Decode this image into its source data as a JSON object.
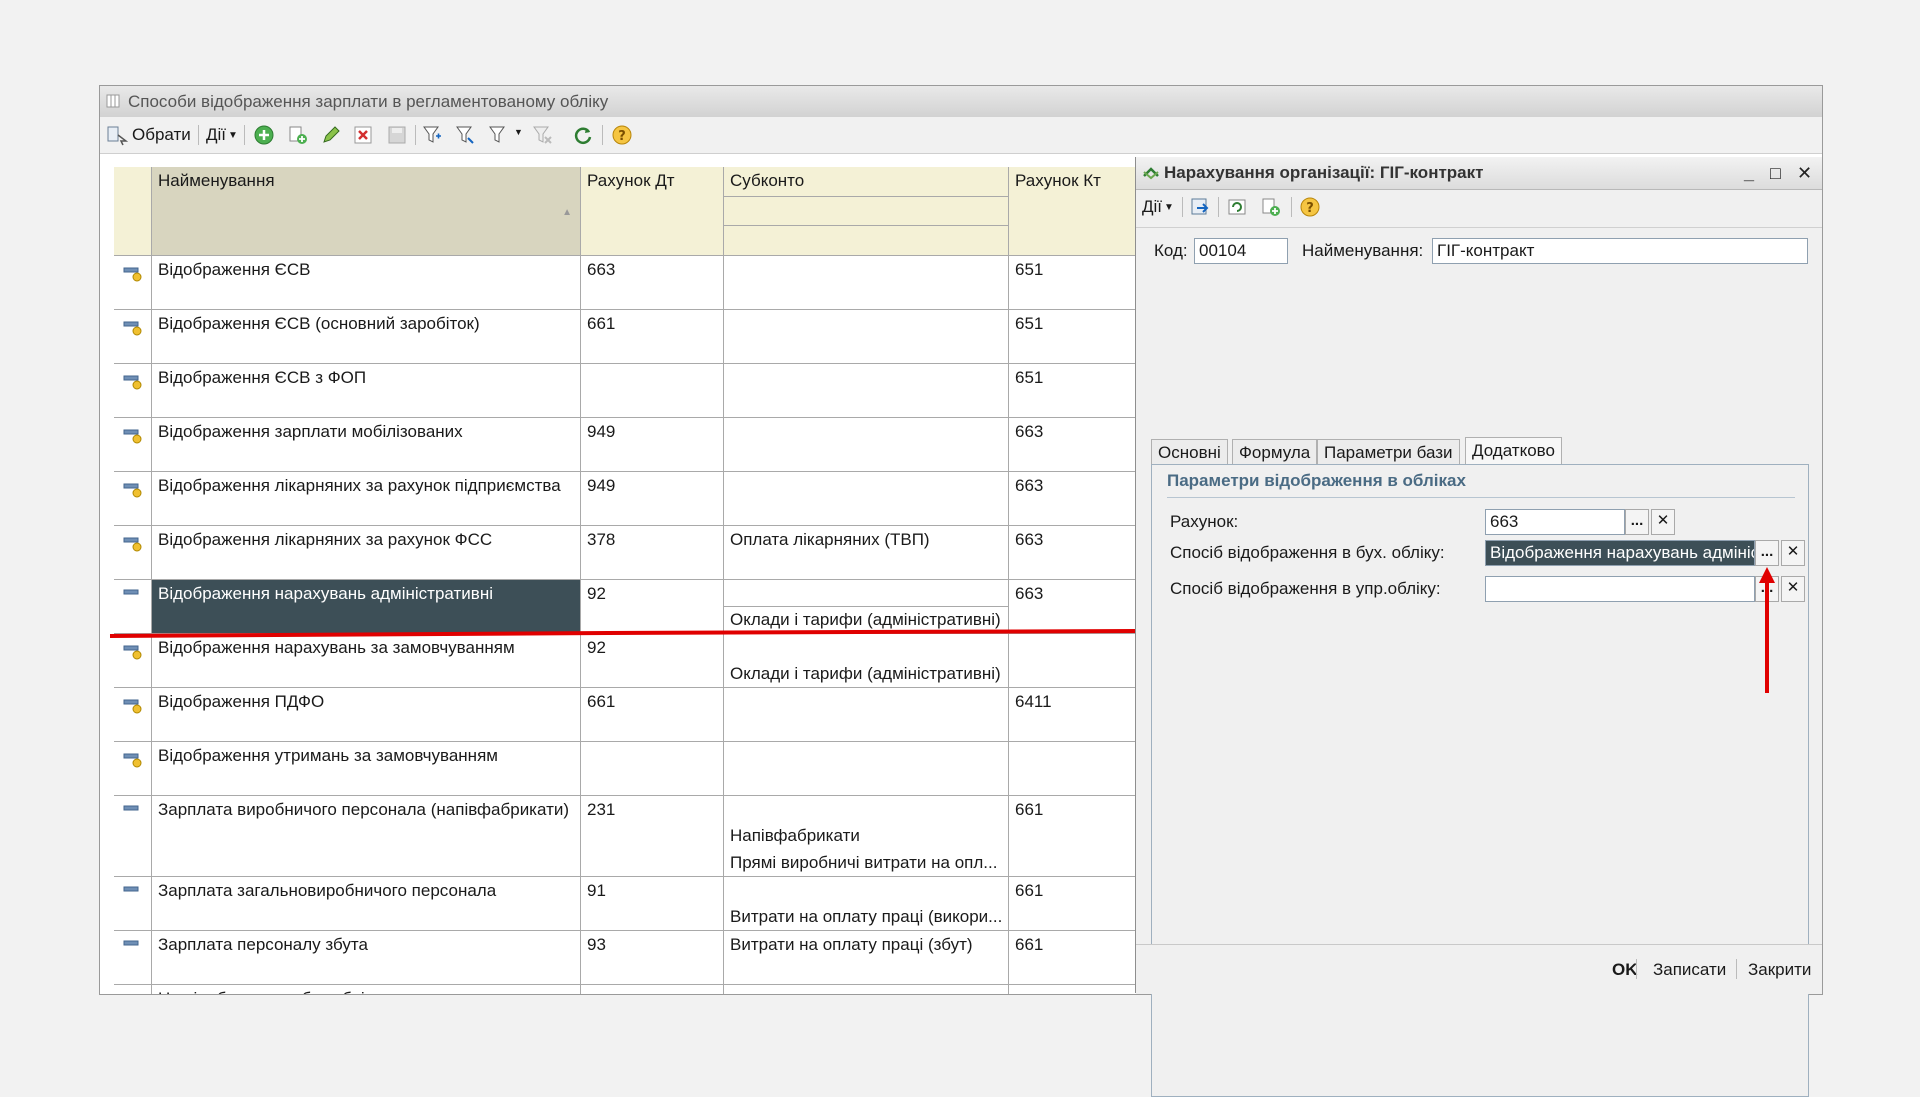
{
  "main": {
    "title": "Способи відображення зарплати в регламентованому обліку",
    "toolbar": {
      "select_label": "Обрати",
      "actions_label": "Дії"
    }
  },
  "table": {
    "headers": {
      "name": "Найменування",
      "debit": "Рахунок Дт",
      "subconto": "Субконто",
      "credit": "Рахунок Кт"
    },
    "rows": [
      {
        "name": "Відображення ЄСВ",
        "debit": "663",
        "sub1": "",
        "sub2": "",
        "credit": "651"
      },
      {
        "name": "Відображення ЄСВ (основний заробіток)",
        "debit": "661",
        "sub1": "",
        "sub2": "",
        "credit": "651"
      },
      {
        "name": "Відображення ЄСВ з ФОП",
        "debit": "",
        "sub1": "",
        "sub2": "",
        "credit": "651"
      },
      {
        "name": "Відображення зарплати мобілізованих",
        "debit": "949",
        "sub1": "",
        "sub2": "",
        "credit": "663"
      },
      {
        "name": "Відображення лікарняних за рахунок підприємства",
        "debit": "949",
        "sub1": "",
        "sub2": "",
        "credit": "663"
      },
      {
        "name": "Відображення лікарняних за рахунок ФСС",
        "debit": "378",
        "sub1": "Оплата лікарняних (ТВП)",
        "sub2": "",
        "credit": "663"
      },
      {
        "name": "Відображення нарахувань адміністративні",
        "debit": "92",
        "sub1": "",
        "sub2": "Оклади і тарифи (адміністративні)",
        "credit": "663"
      },
      {
        "name": "Відображення нарахувань за замовчуванням",
        "debit": "92",
        "sub1": "",
        "sub2": "Оклади і тарифи (адміністративні)",
        "credit": ""
      },
      {
        "name": "Відображення ПДФО",
        "debit": "661",
        "sub1": "",
        "sub2": "",
        "credit": "6411"
      },
      {
        "name": "Відображення утримань за замовчуванням",
        "debit": "",
        "sub1": "",
        "sub2": "",
        "credit": ""
      },
      {
        "name": "Зарплата виробничого персонала (напівфабрикати)",
        "debit": "231",
        "sub1": "Напівфабрикати",
        "sub2": "Прямі виробничі витрати на опл...",
        "credit": "661"
      },
      {
        "name": "Зарплата загальновиробничого персонала",
        "debit": "91",
        "sub1": "",
        "sub2": "Витрати на оплату праці (викори...",
        "credit": "661"
      },
      {
        "name": "Зарплата персоналу збута",
        "debit": "93",
        "sub1": "Витрати на оплату праці (збут)",
        "sub2": "",
        "credit": "661"
      },
      {
        "name": "Не відображати в бух.обліку",
        "debit": "",
        "sub1": "",
        "sub2": "",
        "credit": ""
      }
    ]
  },
  "dialog": {
    "title": "Нарахування організації: ГІГ-контракт",
    "actions_label": "Дії",
    "code_label": "Код:",
    "code_value": "00104",
    "name_label": "Найменування:",
    "name_value": "ГІГ-контракт",
    "tabs": [
      "Основні",
      "Формула",
      "Параметри бази",
      "Додатково"
    ],
    "section_title": "Параметри відображення в обліках",
    "account_label": "Рахунок:",
    "account_value": "663",
    "bu_label": "Спосіб відображення в бух. обліку:",
    "bu_value": "Відображення нарахувань адміністративні",
    "upr_label": "Спосіб відображення в упр.обліку:",
    "upr_value": "",
    "buttons": {
      "ok": "OK",
      "save": "Записати",
      "close": "Закрити"
    }
  },
  "colors": {
    "selection": "#3d4f57",
    "header": "#f4f1d6",
    "annotation": "#e00000"
  }
}
